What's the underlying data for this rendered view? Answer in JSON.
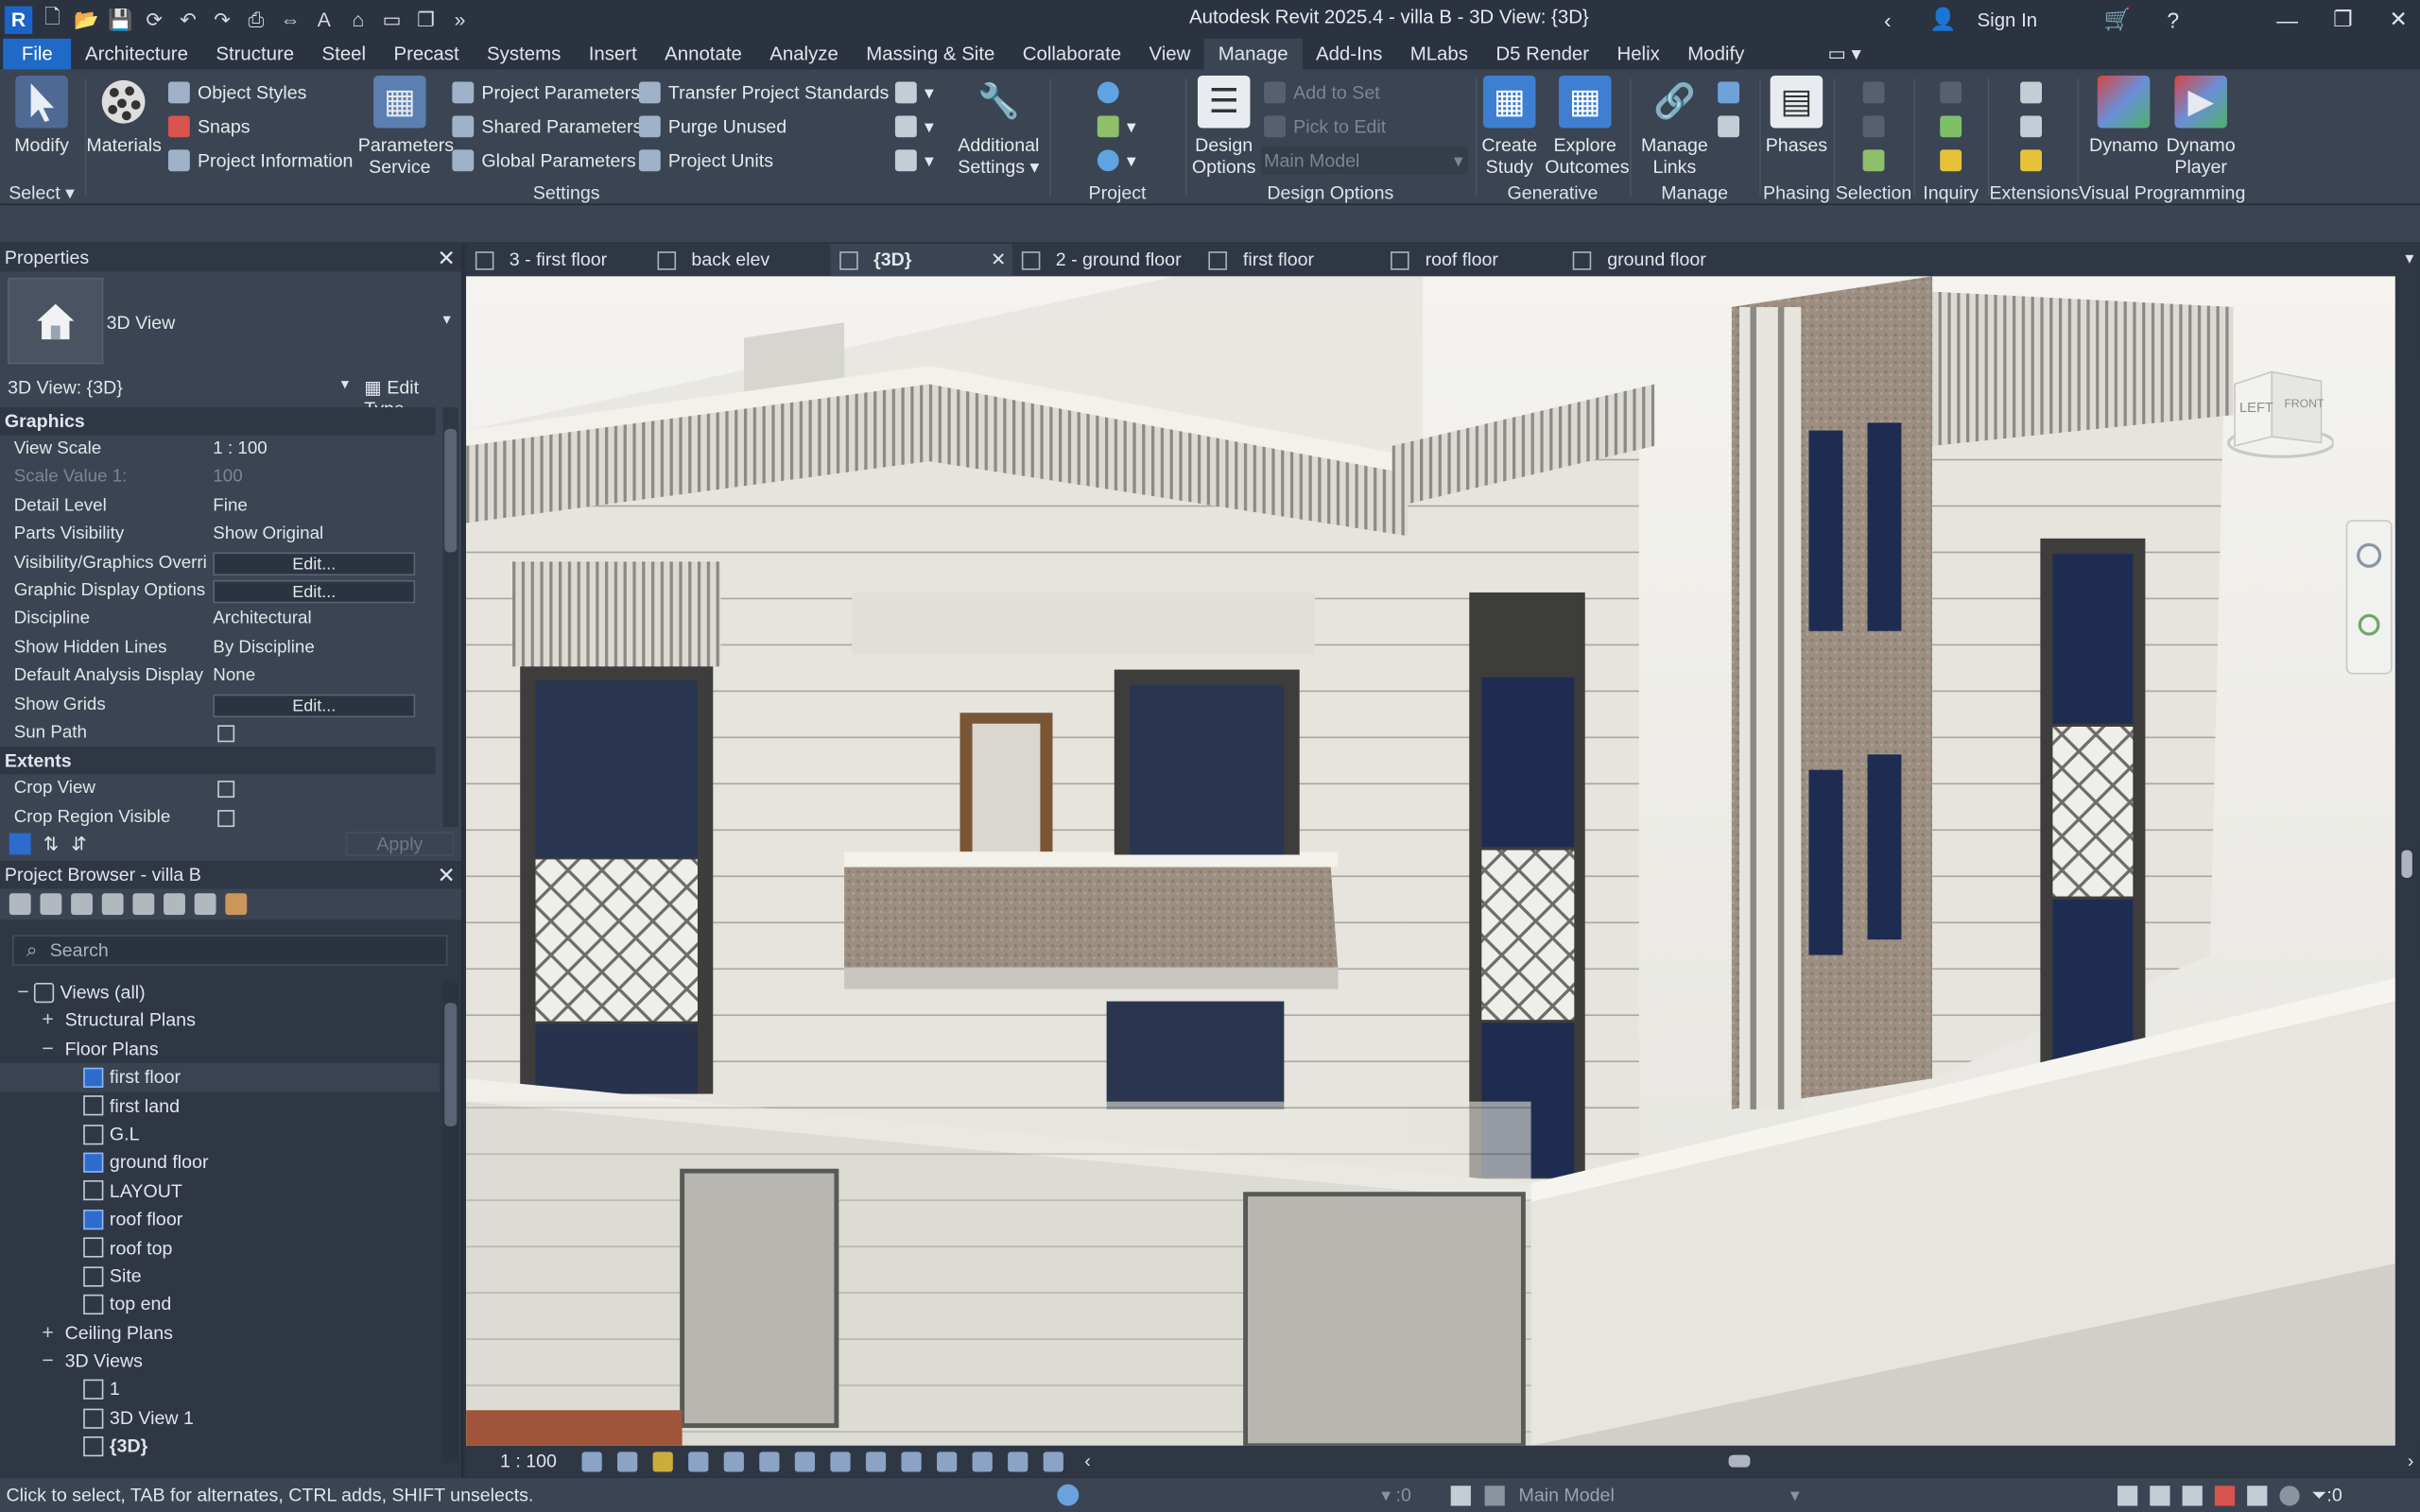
{
  "app": {
    "title": "Autodesk Revit 2025.4 - villa B - 3D View: {3D}",
    "sign_in": "Sign In",
    "logo_letter": "R"
  },
  "menu": {
    "tabs": [
      "File",
      "Architecture",
      "Structure",
      "Steel",
      "Precast",
      "Systems",
      "Insert",
      "Annotate",
      "Analyze",
      "Massing & Site",
      "Collaborate",
      "View",
      "Manage",
      "Add-Ins",
      "MLabs",
      "D5 Render",
      "Helix",
      "Modify"
    ],
    "active": "Manage"
  },
  "ribbon": {
    "select": {
      "modify": "Modify",
      "panel": "Select"
    },
    "settings": {
      "materials": "Materials",
      "object_styles": "Object  Styles",
      "snaps": "Snaps",
      "project_information": "Project  Information",
      "parameters_service_1": "Parameters",
      "parameters_service_2": "Service",
      "project_parameters": "Project  Parameters",
      "shared_parameters": "Shared  Parameters",
      "global_parameters": "Global  Parameters",
      "transfer_standards": "Transfer  Project Standards",
      "purge_unused": "Purge  Unused",
      "project_units": "Project  Units",
      "additional_1": "Additional",
      "additional_2": "Settings",
      "panel": "Settings"
    },
    "project_location": {
      "panel": "Project Location"
    },
    "design_options": {
      "btn_1": "Design",
      "btn_2": "Options",
      "add_to_set": "Add to Set",
      "pick_to_edit": "Pick to Edit",
      "main_model": "Main Model",
      "panel": "Design Options"
    },
    "generative_design": {
      "create_1": "Create",
      "create_2": "Study",
      "explore_1": "Explore",
      "explore_2": "Outcomes",
      "panel": "Generative Design"
    },
    "manage_project": {
      "btn_1": "Manage",
      "btn_2": "Links",
      "panel": "Manage Project"
    },
    "phasing": {
      "btn": "Phases",
      "panel": "Phasing"
    },
    "selection": {
      "panel": "Selection"
    },
    "inquiry": {
      "panel": "Inquiry"
    },
    "extensions": {
      "panel": "Extensions"
    },
    "visual_programming": {
      "dynamo": "Dynamo",
      "player_1": "Dynamo",
      "player_2": "Player",
      "panel": "Visual Programming"
    }
  },
  "properties": {
    "title": "Properties",
    "type_name": "3D View",
    "view_selector": "3D View: {3D}",
    "edit_type": "Edit Type",
    "sections": [
      {
        "name": "Graphics",
        "rows": [
          {
            "key": "View Scale",
            "value": "1 : 100",
            "kind": "text"
          },
          {
            "key": "Scale Value    1:",
            "value": "100",
            "kind": "dim"
          },
          {
            "key": "Detail Level",
            "value": "Fine",
            "kind": "text"
          },
          {
            "key": "Parts Visibility",
            "value": "Show Original",
            "kind": "text"
          },
          {
            "key": "Visibility/Graphics Overri...",
            "value": "Edit...",
            "kind": "button"
          },
          {
            "key": "Graphic Display Options",
            "value": "Edit...",
            "kind": "button"
          },
          {
            "key": "Discipline",
            "value": "Architectural",
            "kind": "text"
          },
          {
            "key": "Show Hidden Lines",
            "value": "By Discipline",
            "kind": "text"
          },
          {
            "key": "Default Analysis Display ...",
            "value": "None",
            "kind": "text"
          },
          {
            "key": "Show Grids",
            "value": "Edit...",
            "kind": "button"
          },
          {
            "key": "Sun Path",
            "value": "",
            "kind": "check"
          }
        ]
      },
      {
        "name": "Extents",
        "rows": [
          {
            "key": "Crop View",
            "value": "",
            "kind": "check"
          },
          {
            "key": "Crop Region Visible",
            "value": "",
            "kind": "check"
          }
        ]
      }
    ],
    "apply": "Apply"
  },
  "browser": {
    "title": "Project Browser - villa B",
    "search_placeholder": "Search",
    "tree": [
      {
        "label": "Views (all)",
        "level": 0,
        "toggle": "−",
        "icon": "views"
      },
      {
        "label": "Structural Plans",
        "level": 1,
        "toggle": "+",
        "icon": ""
      },
      {
        "label": "Floor Plans",
        "level": 1,
        "toggle": "−",
        "icon": ""
      },
      {
        "label": "first floor",
        "level": 2,
        "toggle": "",
        "icon": "blue",
        "selected": true
      },
      {
        "label": "first land",
        "level": 2,
        "toggle": "",
        "icon": "plain"
      },
      {
        "label": "G.L",
        "level": 2,
        "toggle": "",
        "icon": "plain"
      },
      {
        "label": "ground floor",
        "level": 2,
        "toggle": "",
        "icon": "blue"
      },
      {
        "label": "LAYOUT",
        "level": 2,
        "toggle": "",
        "icon": "plain"
      },
      {
        "label": "roof floor",
        "level": 2,
        "toggle": "",
        "icon": "blue"
      },
      {
        "label": "roof top",
        "level": 2,
        "toggle": "",
        "icon": "plain"
      },
      {
        "label": "Site",
        "level": 2,
        "toggle": "",
        "icon": "plain"
      },
      {
        "label": "top end",
        "level": 2,
        "toggle": "",
        "icon": "plain"
      },
      {
        "label": "Ceiling Plans",
        "level": 1,
        "toggle": "+",
        "icon": ""
      },
      {
        "label": "3D Views",
        "level": 1,
        "toggle": "−",
        "icon": ""
      },
      {
        "label": "1",
        "level": 2,
        "toggle": "",
        "icon": "plain"
      },
      {
        "label": "3D View 1",
        "level": 2,
        "toggle": "",
        "icon": "plain"
      },
      {
        "label": "{3D}",
        "level": 2,
        "toggle": "",
        "icon": "plain",
        "bold": true
      }
    ]
  },
  "view_tabs": [
    {
      "label": "3 - first floor",
      "active": false
    },
    {
      "label": "back elev",
      "active": false
    },
    {
      "label": "{3D}",
      "active": true
    },
    {
      "label": "2 - ground floor",
      "active": false
    },
    {
      "label": "first floor",
      "active": false
    },
    {
      "label": "roof floor",
      "active": false
    },
    {
      "label": "ground floor",
      "active": false
    }
  ],
  "viewcube": {
    "left": "LEFT",
    "front": "FRONT"
  },
  "view_control": {
    "scale": "1 : 100"
  },
  "status": {
    "hint": "Click to select, TAB for alternates, CTRL adds, SHIFT unselects.",
    "worksets": ":0",
    "model": "Main Model",
    "filter": ":0"
  }
}
